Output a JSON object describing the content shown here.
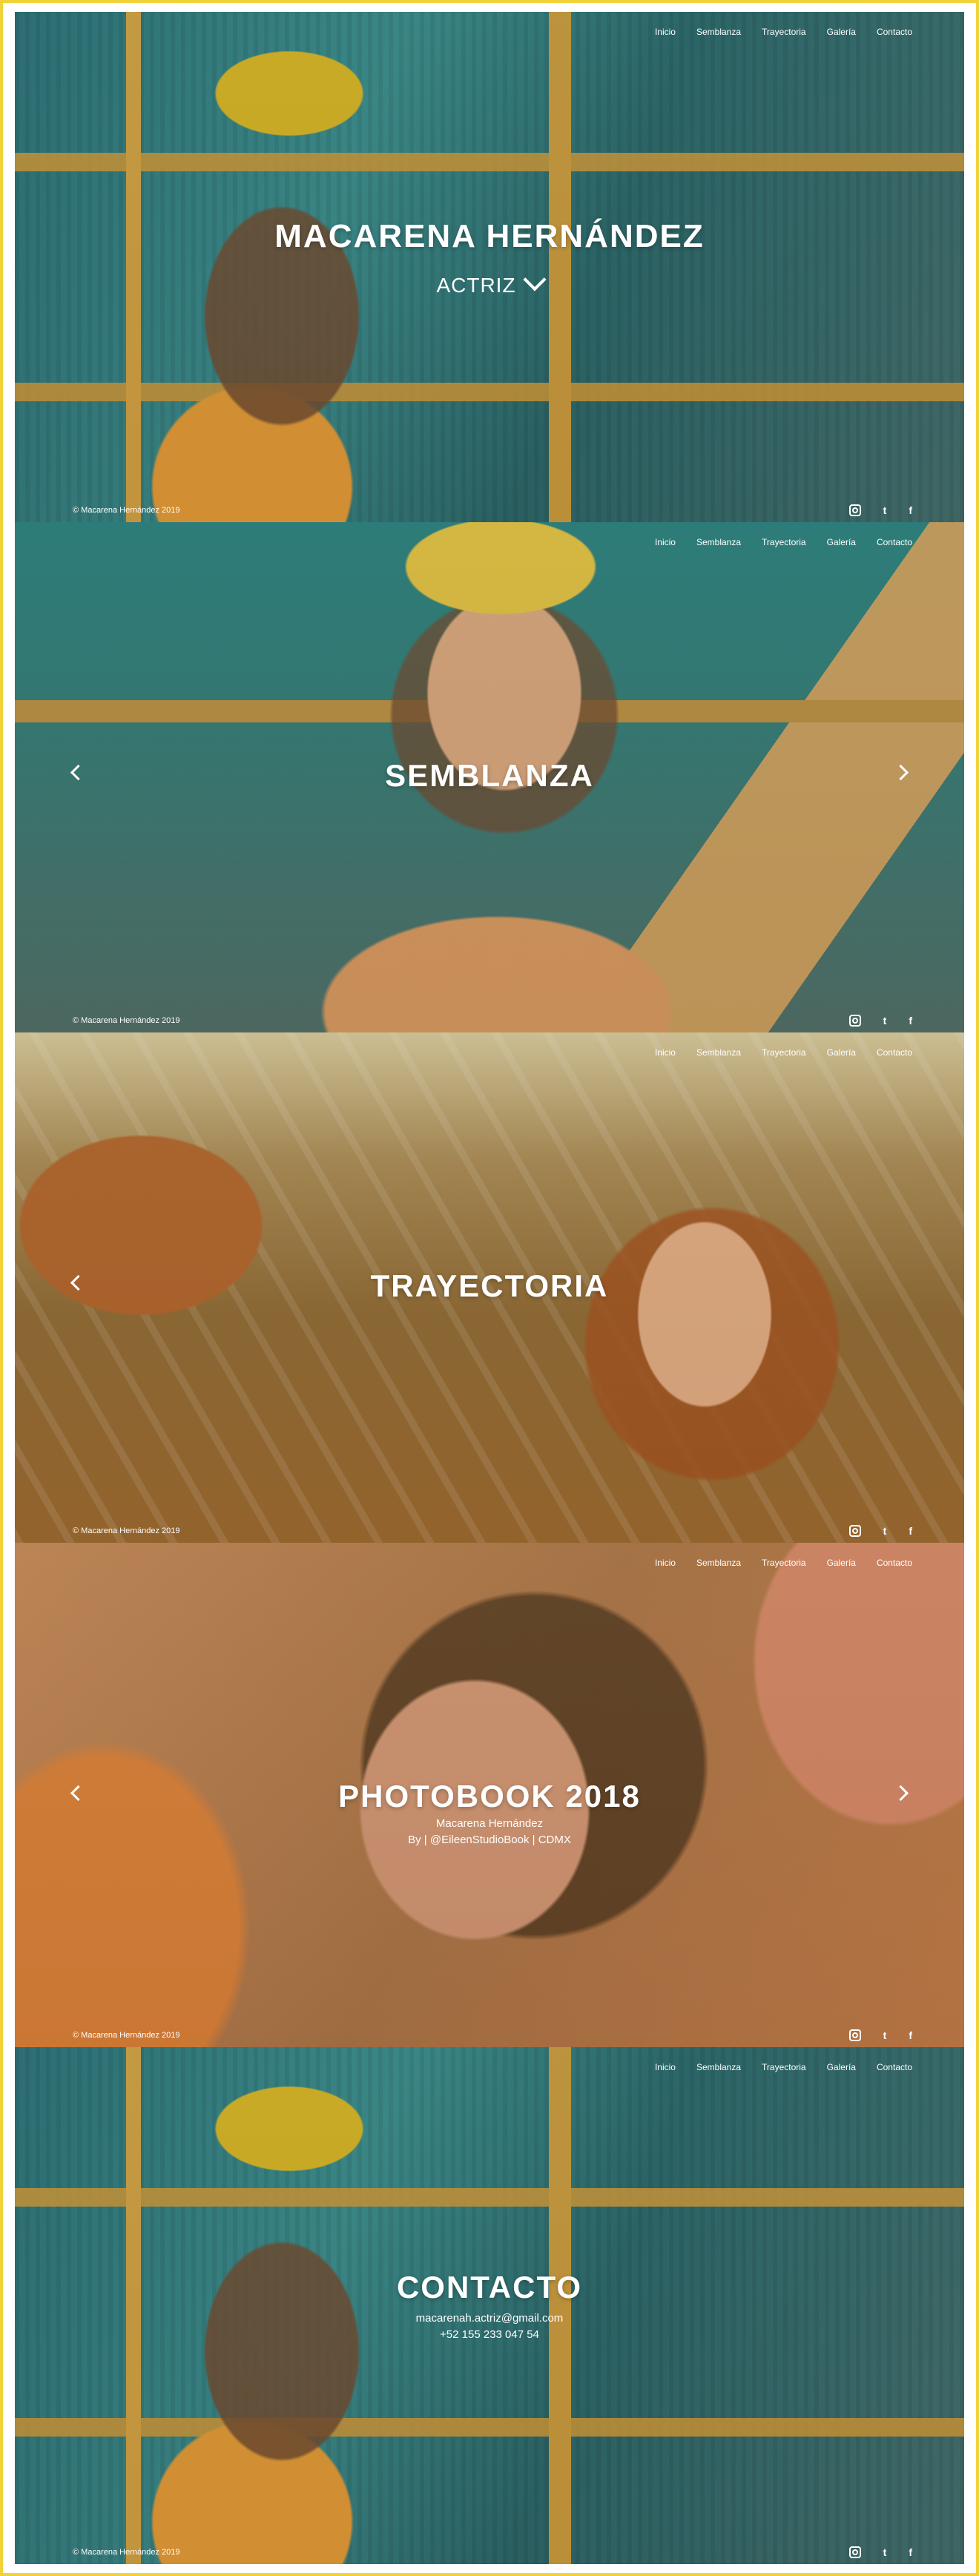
{
  "nav": {
    "items": [
      "Inicio",
      "Semblanza",
      "Trayectoria",
      "Galería",
      "Contacto"
    ]
  },
  "footer": {
    "copyright": "© Macarena Hernández 2019",
    "social": [
      "instagram-icon",
      "twitter-icon",
      "facebook-icon"
    ],
    "twitter_glyph": "t",
    "facebook_glyph": "f"
  },
  "hero": {
    "title": "MACARENA HERNÁNDEZ",
    "subtitle": "ACTRIZ"
  },
  "semblanza": {
    "title": "SEMBLANZA"
  },
  "trayectoria": {
    "title": "TRAYECTORIA"
  },
  "galeria": {
    "title": "PHOTOBOOK 2018",
    "line1": "Macarena Hernández",
    "line2": "By | @EileenStudioBook | CDMX"
  },
  "contacto": {
    "title": "CONTACTO",
    "email": "macarenah.actriz@gmail.com",
    "phone": "+52 155 233 047 54"
  },
  "colors": {
    "frame": "#f2d23a",
    "text": "#ffffff"
  }
}
